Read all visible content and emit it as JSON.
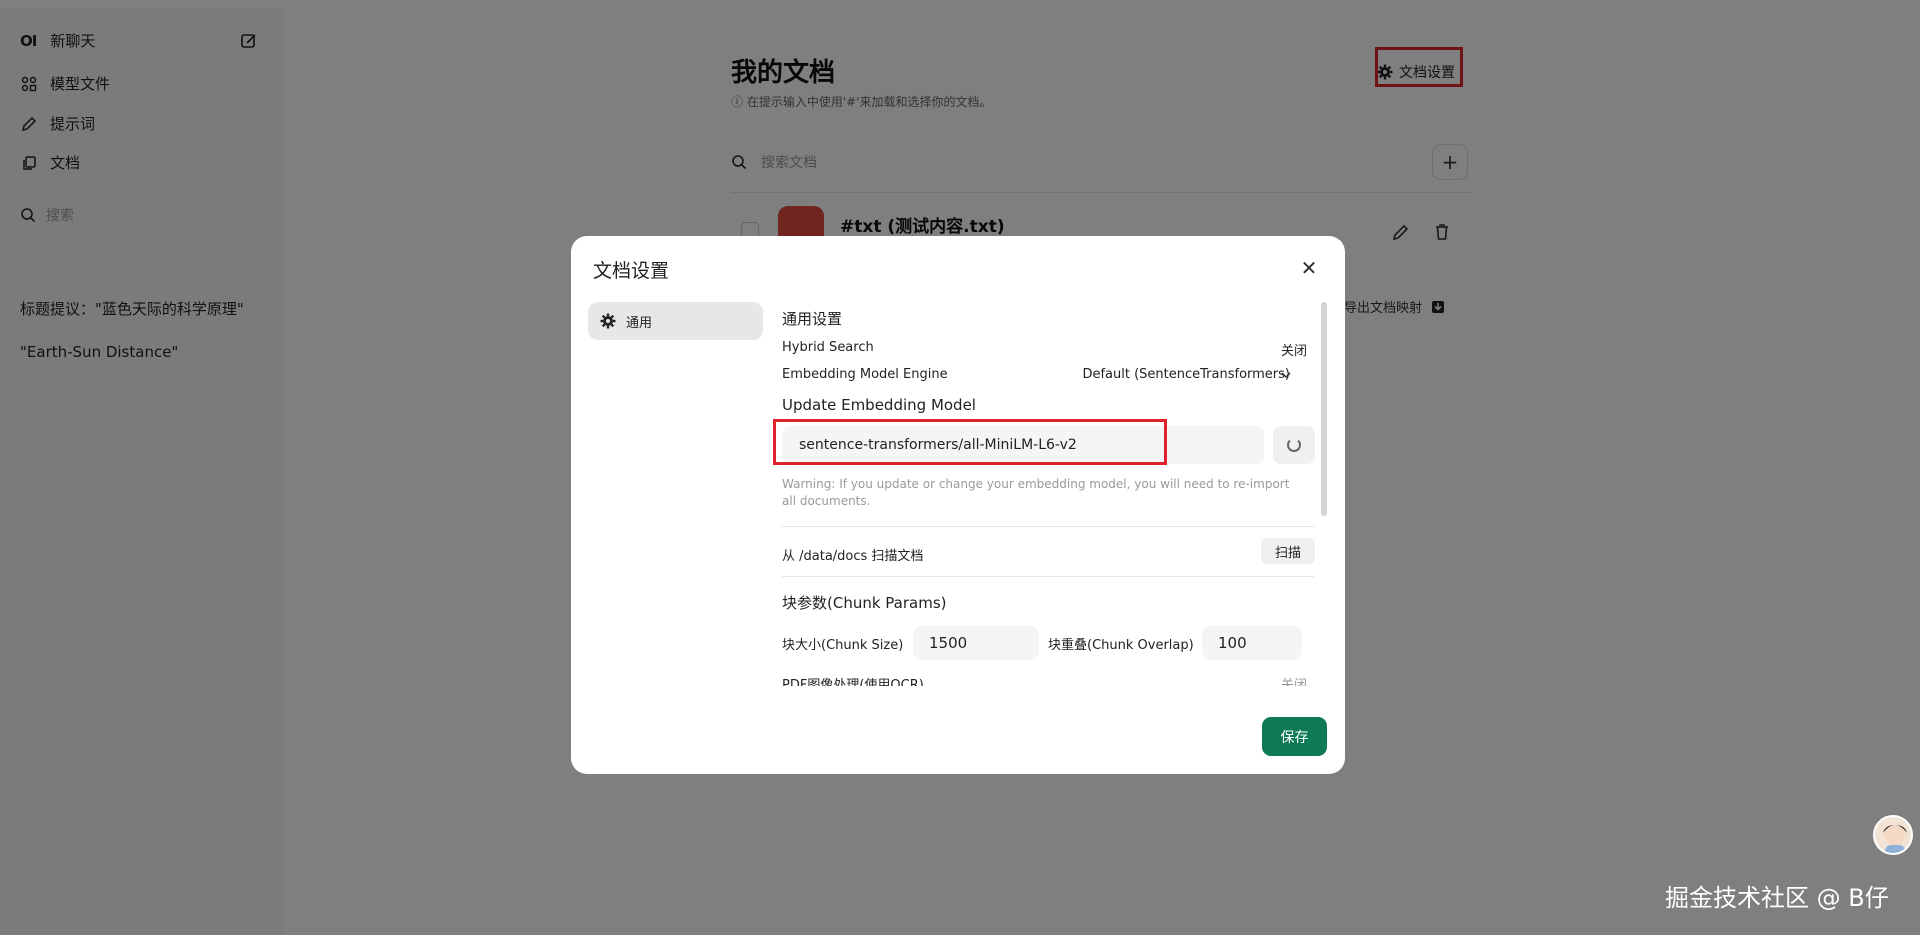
{
  "sidebar": {
    "logo": "OI",
    "new_chat": "新聊天",
    "items": [
      {
        "label": "模型文件",
        "icon": "models-icon"
      },
      {
        "label": "提示词",
        "icon": "pencil-icon"
      },
      {
        "label": "文档",
        "icon": "documents-icon"
      }
    ],
    "search_placeholder": "搜索",
    "chats": [
      "标题提议：\"蓝色天际的科学原理\"",
      "\"Earth-Sun Distance\""
    ]
  },
  "main": {
    "title": "我的文档",
    "hint": "ⓘ 在提示输入中使用'#'来加载和选择你的文档。",
    "doc_settings_label": "文档设置",
    "search_placeholder": "搜索文档",
    "add_label": "+",
    "document": {
      "title": "#txt (测试内容.txt)"
    },
    "export_label": "导出文档映射"
  },
  "modal": {
    "title": "文档设置",
    "close_label": "✕",
    "tab": "通用",
    "general_settings": "通用设置",
    "hybrid_search_label": "Hybrid Search",
    "hybrid_search_value": "关闭",
    "embedding_engine_label": "Embedding Model Engine",
    "embedding_engine_value": "Default (SentenceTransformers)",
    "update_model_title": "Update Embedding Model",
    "model_value": "sentence-transformers/all-MiniLM-L6-v2",
    "warning": "Warning: If you update or change your embedding model, you will need to re-import all documents.",
    "scan_label": "从 /data/docs 扫描文档",
    "scan_button": "扫描",
    "chunk_title": "块参数(Chunk Params)",
    "chunk_size_label": "块大小(Chunk Size)",
    "chunk_size_value": "1500",
    "chunk_overlap_label": "块重叠(Chunk Overlap)",
    "chunk_overlap_value": "100",
    "pdf_ocr_label": "PDF图像处理(使用OCR)",
    "pdf_ocr_value": "关闭",
    "save_label": "保存"
  },
  "watermark": "掘金技术社区 @ B仔",
  "colors": {
    "accent": "#0d7a55",
    "highlight": "#e0242e",
    "file_icon": "#e04a3f"
  }
}
